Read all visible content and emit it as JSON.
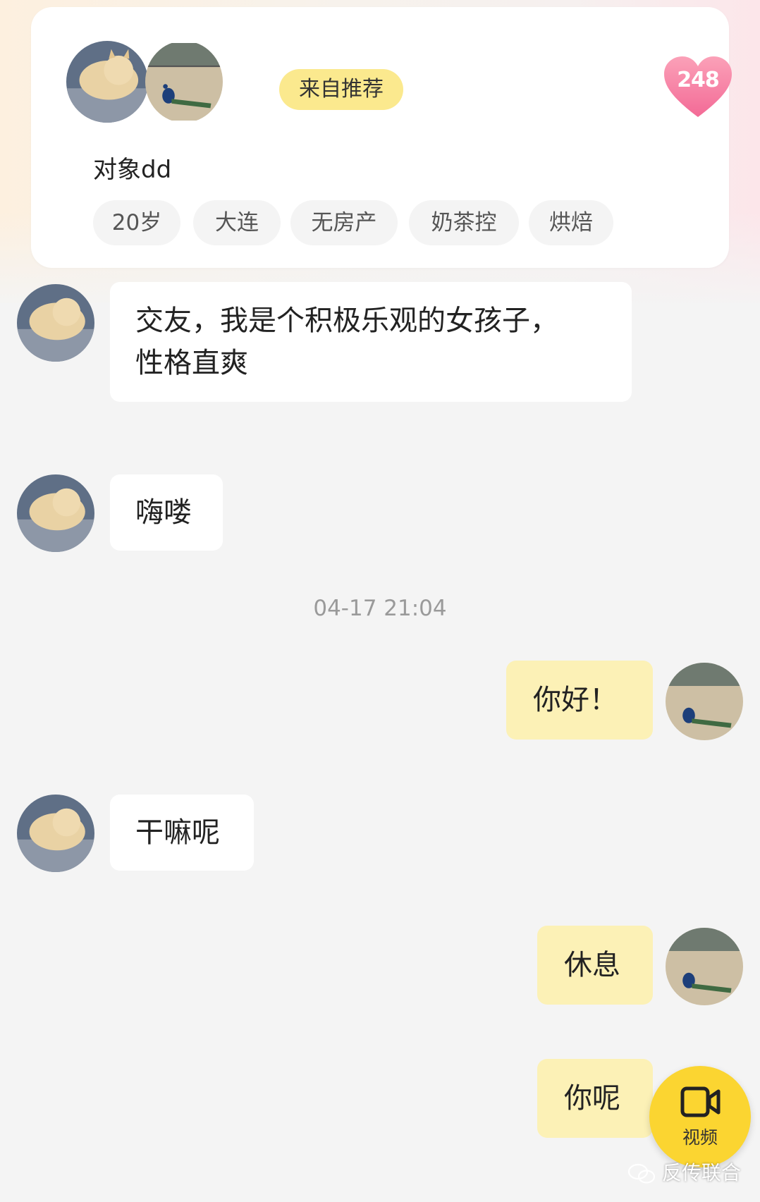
{
  "profile": {
    "recommend_badge": "来自推荐",
    "heart_count": "248",
    "nickname": "对象dd",
    "tags": [
      "20岁",
      "大连",
      "无房产",
      "奶茶控",
      "烘焙"
    ]
  },
  "messages": [
    {
      "from": "them",
      "text_line1": "交友，我是个积极乐观的女孩子，",
      "text_line2": "性格直爽"
    },
    {
      "from": "them",
      "text": "嗨喽"
    },
    {
      "from": "me",
      "text": "你好！"
    },
    {
      "from": "them",
      "text": "干嘛呢"
    },
    {
      "from": "me",
      "text": "休息"
    },
    {
      "from": "me",
      "text": "你呢"
    }
  ],
  "timestamp": "04-17 21:04",
  "video_button": {
    "label": "视频",
    "icon": "video-camera-icon"
  },
  "watermark": "反传联合",
  "colors": {
    "accent_yellow": "#fbd531",
    "badge_yellow": "#fbe98e",
    "outgoing_bubble": "#fcf1b6",
    "heart_pink": "#f7799f"
  }
}
